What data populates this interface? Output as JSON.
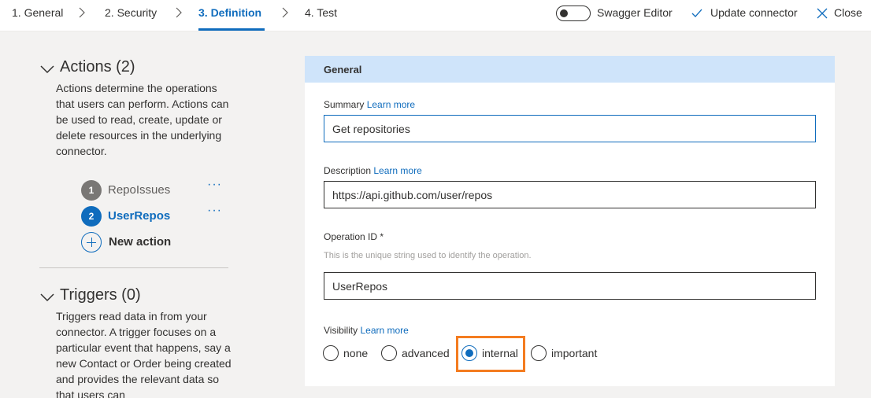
{
  "wizard": {
    "steps": [
      {
        "label": "1. General"
      },
      {
        "label": "2. Security"
      },
      {
        "label": "3. Definition",
        "active": true
      },
      {
        "label": "4. Test"
      }
    ],
    "swagger_editor_label": "Swagger Editor",
    "swagger_editor_on": false,
    "update_label": "Update connector",
    "close_label": "Close"
  },
  "sidebar": {
    "actions": {
      "title": "Actions (2)",
      "description": "Actions determine the operations that users can perform. Actions can be used to read, create, update or delete resources in the underlying connector.",
      "items": [
        {
          "number": "1",
          "label": "RepoIssues",
          "selected": false
        },
        {
          "number": "2",
          "label": "UserRepos",
          "selected": true
        }
      ],
      "more_label": "···",
      "new_action_label": "New action"
    },
    "triggers": {
      "title": "Triggers (0)",
      "description": "Triggers read data in from your connector. A trigger focuses on a particular event that happens, say a new Contact or Order being created and provides the relevant data so that users can"
    }
  },
  "form": {
    "header": "General",
    "learn_more": "Learn more",
    "summary": {
      "label": "Summary",
      "value": "Get repositories"
    },
    "description": {
      "label": "Description",
      "value": "https://api.github.com/user/repos"
    },
    "operation_id": {
      "label": "Operation ID *",
      "hint": "This is the unique string used to identify the operation.",
      "value": "UserRepos"
    },
    "visibility": {
      "label": "Visibility",
      "options": [
        "none",
        "advanced",
        "internal",
        "important"
      ],
      "selected": "internal"
    }
  },
  "colors": {
    "accent": "#0f6cbd",
    "highlight": "#f47c20",
    "header_bg": "#cfe4fa"
  }
}
